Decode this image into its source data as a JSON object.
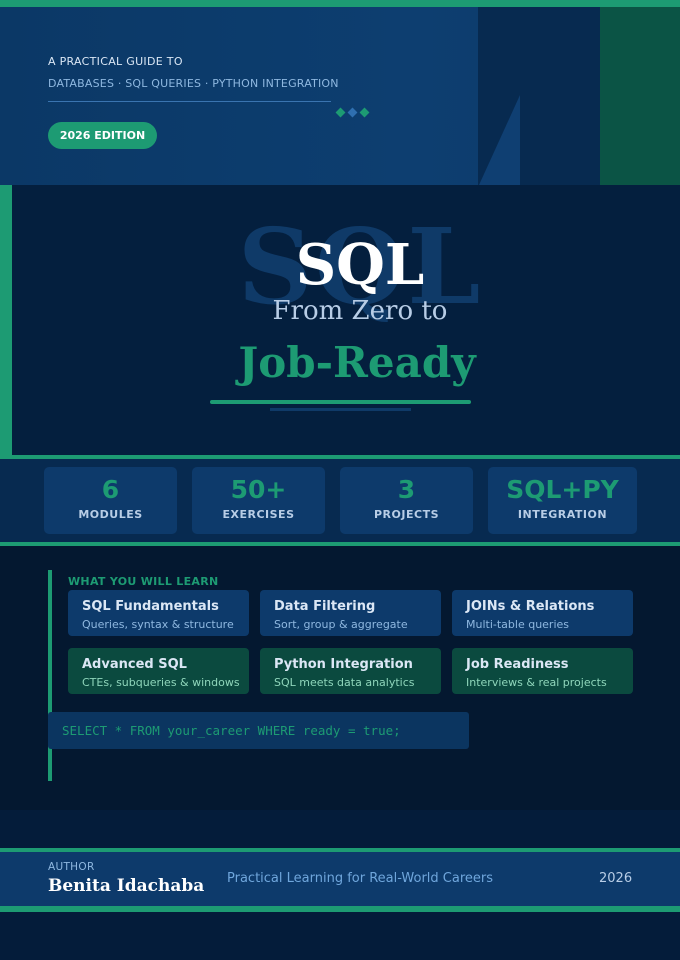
{
  "header": {
    "kicker": "A PRACTICAL GUIDE TO",
    "topics": "DATABASES · SQL QUERIES · PYTHON INTEGRATION",
    "edition": "2026 EDITION"
  },
  "hero": {
    "ghost_text": "SQL",
    "title": "SQL",
    "subtitle": "From Zero to",
    "highlight": "Job-Ready"
  },
  "stats": [
    {
      "value": "6",
      "label": "MODULES"
    },
    {
      "value": "50+",
      "label": "EXERCISES"
    },
    {
      "value": "3",
      "label": "PROJECTS"
    },
    {
      "value": "SQL+PY",
      "label": "INTEGRATION"
    }
  ],
  "learn": {
    "heading": "WHAT YOU WILL LEARN",
    "cards": [
      {
        "title": "SQL Fundamentals",
        "sub": "Queries, syntax & structure"
      },
      {
        "title": "Data Filtering",
        "sub": "Sort, group & aggregate"
      },
      {
        "title": "JOINs & Relations",
        "sub": "Multi-table queries"
      },
      {
        "title": "Advanced SQL",
        "sub": "CTEs, subqueries & windows"
      },
      {
        "title": "Python Integration",
        "sub": "SQL meets data analytics"
      },
      {
        "title": "Job Readiness",
        "sub": "Interviews & real projects"
      }
    ],
    "code": "SELECT * FROM your_career WHERE ready = true;"
  },
  "footer": {
    "author_label": "AUTHOR",
    "author_name": "Benita Idachaba",
    "tagline": "Practical Learning for Real-World Careers",
    "year": "2026"
  },
  "colors": {
    "accent_green": "#1d9b73",
    "navy": "#041c3a",
    "blue_card": "#0d3a6b",
    "green_card": "#0b4a3f"
  }
}
